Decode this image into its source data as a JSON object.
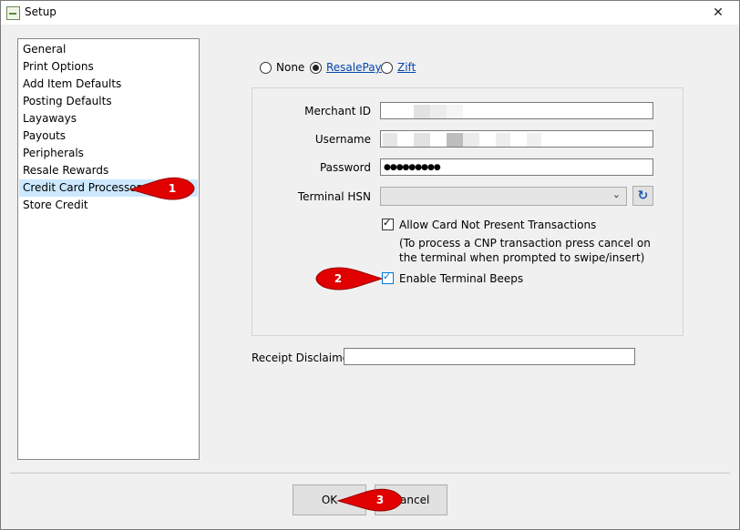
{
  "window": {
    "title": "Setup",
    "close_glyph": "✕"
  },
  "nav": {
    "items": [
      {
        "label": "General"
      },
      {
        "label": "Print Options"
      },
      {
        "label": "Add Item Defaults"
      },
      {
        "label": "Posting Defaults"
      },
      {
        "label": "Layaways"
      },
      {
        "label": "Payouts"
      },
      {
        "label": "Peripherals"
      },
      {
        "label": "Resale Rewards"
      },
      {
        "label": "Credit Card Processor",
        "selected": true
      },
      {
        "label": "Store Credit"
      }
    ]
  },
  "processor": {
    "options": [
      {
        "label": "None",
        "checked": false
      },
      {
        "label": "ResalePay",
        "checked": true
      },
      {
        "label": "Zift",
        "checked": false
      }
    ]
  },
  "form": {
    "merchant_id_label": "Merchant ID",
    "username_label": "Username",
    "password_label": "Password",
    "password_value": "●●●●●●●●●",
    "terminal_hsn_label": "Terminal HSN",
    "allow_cnp": {
      "label": "Allow Card Not Present Transactions",
      "checked": true
    },
    "cnp_note": "(To process a CNP transaction press cancel on the terminal when prompted to swipe/insert)",
    "enable_beeps": {
      "label": "Enable Terminal Beeps",
      "checked": true
    },
    "receipt_disclaimer_label": "Receipt Disclaimer",
    "receipt_disclaimer_value": ""
  },
  "buttons": {
    "ok": "OK",
    "cancel": "Cancel"
  },
  "callouts": [
    "1",
    "2",
    "3"
  ],
  "icons": {
    "refresh": "↻",
    "dropdown": "⌄",
    "check": "✓"
  },
  "colors": {
    "callout_red": "#e00000",
    "selection": "#cce8ff",
    "accent_blue": "#0078d7"
  }
}
